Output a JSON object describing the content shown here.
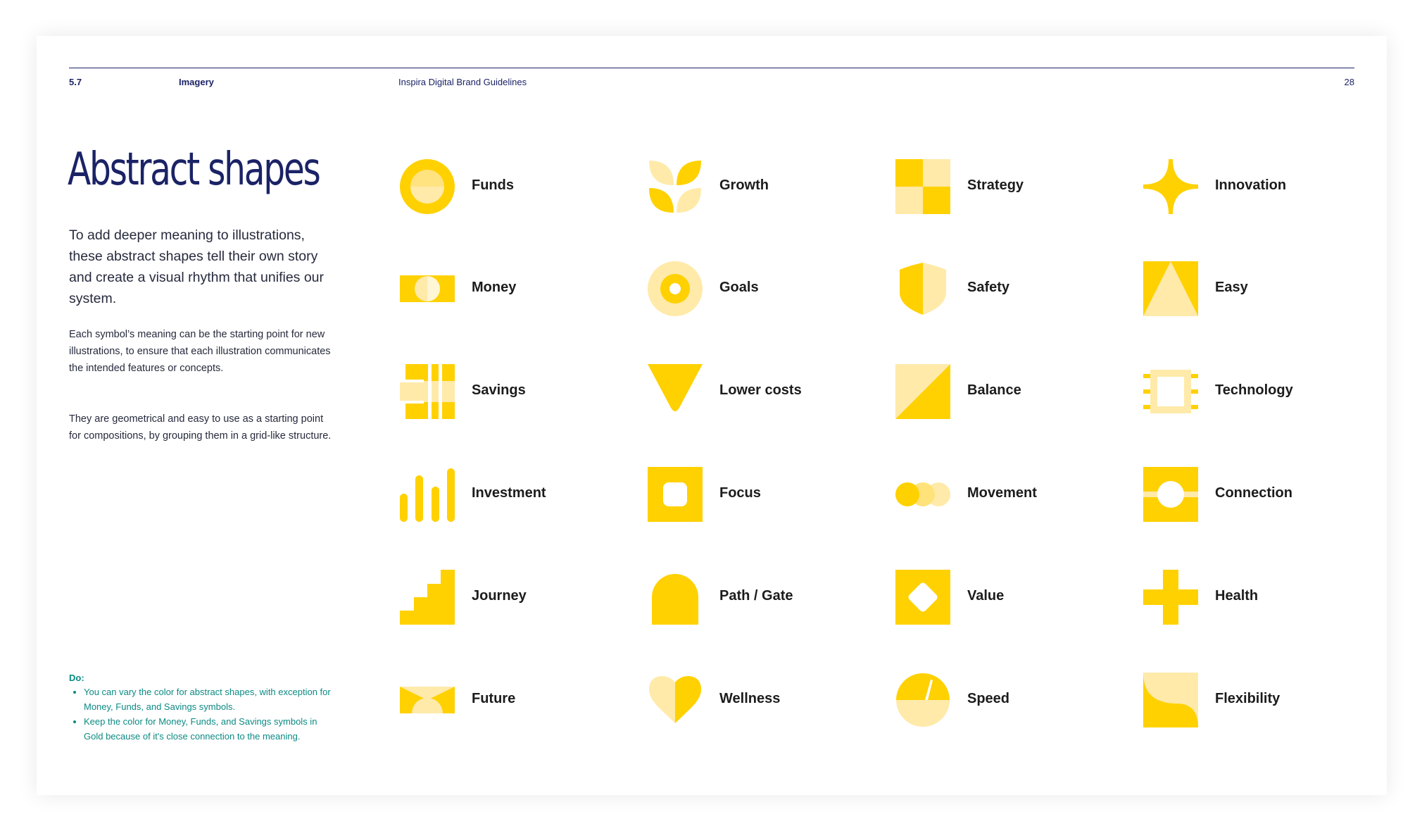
{
  "header": {
    "section_number": "5.7",
    "section_name": "Imagery",
    "document_title": "Inspira Digital Brand Guidelines",
    "page_number": "28"
  },
  "title": "Abstract shapes",
  "lead": "To add deeper meaning to illustrations, these abstract shapes tell their own story and create a visual rhythm that unifies our system.",
  "paragraphs": [
    "Each symbol’s meaning can be the starting point for new illustrations, to ensure that each illustration communicates the intended features or concepts.",
    "They are geometrical and easy to use as a starting point for compositions, by grouping them in a grid-like structure."
  ],
  "note": {
    "title": "Do:",
    "items": [
      "You can vary the color for abstract shapes, with exception for Money, Funds, and Savings symbols.",
      "Keep the color for Money, Funds, and Savings symbols in Gold because of it's close connection to the meaning."
    ]
  },
  "colors": {
    "gold": "#ffd100",
    "light_gold": "#ffeaaa",
    "navy": "#1b2366",
    "teal": "#0b8a83"
  },
  "shapes": [
    {
      "label": "Funds",
      "icon": "funds-icon"
    },
    {
      "label": "Growth",
      "icon": "growth-icon"
    },
    {
      "label": "Strategy",
      "icon": "strategy-icon"
    },
    {
      "label": "Innovation",
      "icon": "innovation-icon"
    },
    {
      "label": "Money",
      "icon": "money-icon"
    },
    {
      "label": "Goals",
      "icon": "goals-icon"
    },
    {
      "label": "Safety",
      "icon": "safety-icon"
    },
    {
      "label": "Easy",
      "icon": "easy-icon"
    },
    {
      "label": "Savings",
      "icon": "savings-icon"
    },
    {
      "label": "Lower costs",
      "icon": "lower-costs-icon"
    },
    {
      "label": "Balance",
      "icon": "balance-icon"
    },
    {
      "label": "Technology",
      "icon": "technology-icon"
    },
    {
      "label": "Investment",
      "icon": "investment-icon"
    },
    {
      "label": "Focus",
      "icon": "focus-icon"
    },
    {
      "label": "Movement",
      "icon": "movement-icon"
    },
    {
      "label": "Connection",
      "icon": "connection-icon"
    },
    {
      "label": "Journey",
      "icon": "journey-icon"
    },
    {
      "label": "Path / Gate",
      "icon": "path-gate-icon"
    },
    {
      "label": "Value",
      "icon": "value-icon"
    },
    {
      "label": "Health",
      "icon": "health-icon"
    },
    {
      "label": "Future",
      "icon": "future-icon"
    },
    {
      "label": "Wellness",
      "icon": "wellness-icon"
    },
    {
      "label": "Speed",
      "icon": "speed-icon"
    },
    {
      "label": "Flexibility",
      "icon": "flexibility-icon"
    }
  ]
}
